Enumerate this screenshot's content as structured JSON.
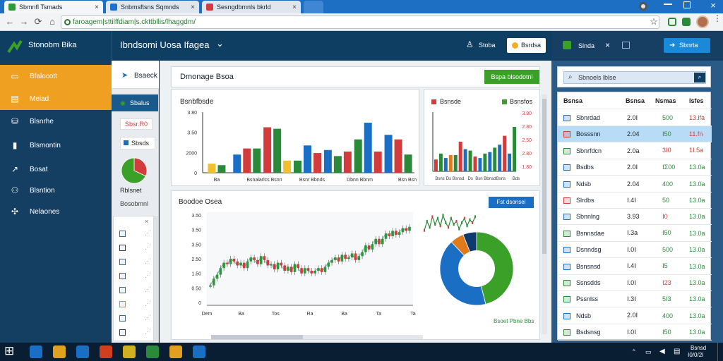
{
  "browser": {
    "tabs": [
      {
        "label": "Sbmnfl Tsmads",
        "icon_color": "#2d9b3a",
        "active": true
      },
      {
        "label": "Snbmsftsns Sqmnds",
        "icon_color": "#1c6fd1",
        "active": false
      },
      {
        "label": "Sesngdbmnls bkrld",
        "icon_color": "#d23c3c",
        "active": false
      }
    ],
    "tab_close": "×",
    "url": "faroagem|sttilffdiam|s.ckttbllis/lhaggdm/",
    "back": "←",
    "forward": "→",
    "reload": "⟳",
    "home": "⌂",
    "star": "☆"
  },
  "app": {
    "brand": "Stonobm Bika",
    "workspace": "Ibndsomi Uosa Ifagea",
    "workspace_caret": "⌄",
    "header_link": "Stoba",
    "header_button": "Bsrdsa",
    "right_header_label": "Slnda",
    "right_header_x": "×",
    "right_header_button": "Sbnrta"
  },
  "sidebar": {
    "items": [
      {
        "label": "Bfalocott",
        "icon": "folder-icon",
        "glyph": "▭",
        "active": true
      },
      {
        "label": "Meiad",
        "icon": "briefcase-icon",
        "glyph": "▤",
        "active": true
      },
      {
        "label": "Blsnrhe",
        "icon": "database-icon",
        "glyph": "⛁",
        "active": false
      },
      {
        "label": "Blsmontin",
        "icon": "document-icon",
        "glyph": "▮",
        "active": false
      },
      {
        "label": "Bosat",
        "icon": "chart-icon",
        "glyph": "↗",
        "active": false
      },
      {
        "label": "Blsntion",
        "icon": "people-icon",
        "glyph": "⚇",
        "active": false
      },
      {
        "label": "Nelaones",
        "icon": "network-icon",
        "glyph": "✣",
        "active": false
      }
    ]
  },
  "column2": {
    "search_label": "Bsaeck",
    "selected_item": "Sbalus",
    "red_value": "Sbsr.R0",
    "blue_item": "Sbsds",
    "pie_label": "Rblsnet",
    "pie_sublabel": "Bosobmnl",
    "list_rows": 8,
    "list_colors": [
      "#1a6fc4",
      "#3a3a3a",
      "#1a6fc4",
      "#1a6fc4",
      "#2a8a3a",
      "#e08a1a",
      "#1a6fc4",
      "#3a3a3a"
    ]
  },
  "main": {
    "page_title": "Dmonage Bsoa",
    "top_button": "Bspa blsodotnl",
    "panel_bar_title": "Bsnbfbsde",
    "panel_line_title": "Boodoe Osea",
    "side_button": "Fst dsonsel",
    "donut_caption": "Bsoet Pbne Bbs",
    "side_bar_legend": [
      "Bsnsde",
      "Bsnsfos"
    ]
  },
  "chart_data": [
    {
      "type": "bar",
      "title": "Bsnbfbsde",
      "yticks": [
        "3.80",
        "3.50",
        "2000",
        "0"
      ],
      "xticks": [
        "Ba",
        "Bsnalarlcs Bsnn",
        "Bsnr Bbnds",
        "Dbnn Bbnm",
        "Bsn Bsn"
      ],
      "ylim": [
        0,
        4
      ],
      "groups": [
        {
          "values": [
            0.6,
            0.5
          ],
          "colors": [
            "#f0c030",
            "#2a8a3a"
          ]
        },
        {
          "values": [
            1.2,
            1.6,
            1.6
          ],
          "colors": [
            "#1a6fc4",
            "#d23c3c",
            "#2a8a3a"
          ]
        },
        {
          "values": [
            3.0,
            2.9,
            0.8
          ],
          "colors": [
            "#d23c3c",
            "#2a8a3a",
            "#f0c030"
          ]
        },
        {
          "values": [
            0.8,
            1.8,
            1.3
          ],
          "colors": [
            "#2a8a3a",
            "#1a6fc4",
            "#d23c3c"
          ]
        },
        {
          "values": [
            1.5,
            1.1,
            1.4
          ],
          "colors": [
            "#1a6fc4",
            "#2a8a3a",
            "#d23c3c"
          ]
        },
        {
          "values": [
            2.2,
            3.3,
            1.4
          ],
          "colors": [
            "#2a8a3a",
            "#1a6fc4",
            "#d23c3c"
          ]
        },
        {
          "values": [
            2.5,
            2.2,
            1.2
          ],
          "colors": [
            "#1a6fc4",
            "#d23c3c",
            "#2a8a3a"
          ]
        }
      ]
    },
    {
      "type": "bar",
      "title": "Bsnsde",
      "yticks": [
        "3.80",
        "2.80",
        "2.50",
        "2.80",
        "1.80"
      ],
      "xticks": [
        "Bsns",
        "Ds Bsnsd",
        "Ds",
        "Bsn Bbnsd",
        "Bsns",
        "Bds"
      ],
      "ylim": [
        0,
        4
      ],
      "values": [
        0.8,
        1.2,
        0.9,
        1.1,
        1.1,
        2.0,
        1.5,
        1.4,
        1.0,
        0.9,
        1.2,
        1.3,
        1.6,
        1.8,
        2.4,
        1.2,
        3.0
      ],
      "colors": [
        "#d23c3c",
        "#2a8a3a",
        "#1a6fc4",
        "#e07a1a",
        "#2a8a3a",
        "#d23c3c",
        "#1a6fc4",
        "#2a8a3a",
        "#d23c3c",
        "#1a6fc4",
        "#2a8a3a",
        "#1a6fc4",
        "#2a8a3a",
        "#1a6fc4",
        "#d23c3c",
        "#1a6fc4",
        "#2a8a3a"
      ]
    },
    {
      "type": "line",
      "title": "Boodoe Osea",
      "yticks": [
        "3.50",
        "3.50",
        "3.50",
        "2.50",
        "1.50",
        "0.50",
        "0"
      ],
      "xticks": [
        "Dem",
        "Ba",
        "Tos",
        "Ra",
        "Ba",
        "Ta",
        "Ta"
      ],
      "ylim": [
        0,
        7
      ],
      "values": [
        1.5,
        2.0,
        2.3,
        2.8,
        3.2,
        3.1,
        3.5,
        3.3,
        3.0,
        3.2,
        2.8,
        3.3,
        3.6,
        3.4,
        3.1,
        3.7,
        3.4,
        3.0,
        3.1,
        2.7,
        3.2,
        3.0,
        2.6,
        2.9,
        2.5,
        3.1,
        2.8,
        2.4,
        2.8,
        2.6,
        2.4,
        2.6,
        2.8,
        2.5,
        2.9,
        3.2,
        3.4,
        3.6,
        3.3,
        3.8,
        3.5,
        3.6,
        3.9,
        3.4,
        3.7,
        4.0,
        4.5,
        4.2,
        4.6,
        5.0,
        4.6,
        5.0,
        5.4,
        5.2,
        5.6,
        5.3,
        5.5,
        5.8,
        5.6,
        5.9
      ]
    },
    {
      "type": "line",
      "title": "",
      "values": [
        2.0,
        2.6,
        2.2,
        2.9,
        2.4,
        2.8,
        2.3,
        3.0,
        2.5,
        2.2,
        2.8,
        2.4,
        2.6,
        2.1,
        2.5,
        2.8,
        2.3,
        2.7,
        2.5,
        2.9
      ]
    },
    {
      "type": "pie",
      "title": "Bsoet Pbne Bbs",
      "labels": [
        "Green",
        "Blue",
        "Orange",
        "Navy"
      ],
      "values": [
        46,
        42,
        6,
        6
      ],
      "colors": [
        "#3aa028",
        "#1a6fc4",
        "#e07a1a",
        "#0e3a6e"
      ],
      "donut": true
    },
    {
      "type": "pie",
      "title": "Rblsnet",
      "labels": [
        "Red",
        "Green"
      ],
      "values": [
        32,
        68
      ],
      "colors": [
        "#d23c3c",
        "#3aa028"
      ]
    }
  ],
  "right_panel": {
    "search_placeholder": "Sbnoels lblse",
    "columns": [
      "Bsnsa",
      "Bsnsa",
      "Nsmas",
      "Isfes"
    ],
    "rows": [
      {
        "name": "Sbnrdad",
        "v1": "2.0Ⅰ",
        "v2": "500",
        "v3": "13.lfa",
        "icon": "#1a6fc4",
        "v3color": "#d23c3c",
        "v2color": "#2a8a3a",
        "highlight": false
      },
      {
        "name": "Bosssnn",
        "v1": "2.04",
        "v2": "Ⅰ50",
        "v3": "11.fn",
        "icon": "#d23c3c",
        "v3color": "#d23c3c",
        "v2color": "#2a8a3a",
        "highlight": true
      },
      {
        "name": "Sbnrfdcn",
        "v1": "2.0a",
        "v2": "3Ⅰ0",
        "v3": "1Ⅰ.5a",
        "icon": "#2a8a3a",
        "v3color": "#d23c3c",
        "v2color": "#d23c3c",
        "highlight": false
      },
      {
        "name": "Bsdbs",
        "v1": "2.0Ⅰ",
        "v2": "ⅠΣ00",
        "v3": "13.0a",
        "icon": "#1a6fc4",
        "v3color": "#2a8a3a",
        "v2color": "#2a8a3a",
        "highlight": false
      },
      {
        "name": "Ndsb",
        "v1": "2.04",
        "v2": "400",
        "v3": "13.0a",
        "icon": "#1a6fc4",
        "v3color": "#2a8a3a",
        "v2color": "#2a8a3a",
        "highlight": false
      },
      {
        "name": "Slrdbs",
        "v1": "Ⅰ.4Ⅰ",
        "v2": "50",
        "v3": "13.0a",
        "icon": "#d23c3c",
        "v3color": "#2a8a3a",
        "v2color": "#2a8a3a",
        "highlight": false
      },
      {
        "name": "Sbnnlng",
        "v1": "3.93",
        "v2": "Ⅰ0",
        "v3": "13.0a",
        "icon": "#1a6fc4",
        "v3color": "#2a8a3a",
        "v2color": "#d23c3c",
        "highlight": false
      },
      {
        "name": "Bsnnsdae",
        "v1": "Ⅰ.3a",
        "v2": "Ⅰ50",
        "v3": "13.0a",
        "icon": "#2a8a3a",
        "v3color": "#2a8a3a",
        "v2color": "#2a8a3a",
        "highlight": false
      },
      {
        "name": "Dsnndsg",
        "v1": "Ⅰ.0Ⅰ",
        "v2": "500",
        "v3": "13.0a",
        "icon": "#1a6fc4",
        "v3color": "#2a8a3a",
        "v2color": "#2a8a3a",
        "highlight": false
      },
      {
        "name": "Bsnsnsd",
        "v1": "Ⅰ.4Ⅰ",
        "v2": "Ⅰ5",
        "v3": "13.0a",
        "icon": "#1a6fc4",
        "v3color": "#2a8a3a",
        "v2color": "#2a8a3a",
        "highlight": false
      },
      {
        "name": "Ssnsdds",
        "v1": "Ⅰ.0Ⅰ",
        "v2": "Ⅰ23",
        "v3": "13.0a",
        "icon": "#2a8a3a",
        "v3color": "#2a8a3a",
        "v2color": "#d23c3c",
        "highlight": false
      },
      {
        "name": "Pssnlss",
        "v1": "Ⅰ.3Ⅰ",
        "v2": "5Ⅰ3",
        "v3": "13.0a",
        "icon": "#2a8a3a",
        "v3color": "#2a8a3a",
        "v2color": "#2a8a3a",
        "highlight": false
      },
      {
        "name": "Ndsb",
        "v1": "2.0Ⅰ",
        "v2": "400",
        "v3": "13.0a",
        "icon": "#1a6fc4",
        "v3color": "#2a8a3a",
        "v2color": "#2a8a3a",
        "highlight": false
      },
      {
        "name": "Bsdsnsg",
        "v1": "Ⅰ.0Ⅰ",
        "v2": "Ⅰ50",
        "v3": "13.0a",
        "icon": "#2a8a3a",
        "v3color": "#2a8a3a",
        "v2color": "#2a8a3a",
        "highlight": false
      }
    ]
  },
  "taskbar": {
    "start_glyph": "⊞",
    "apps": [
      "#1a6fc4",
      "#e0a020",
      "#1a6fc4",
      "#d04020",
      "#d0b020",
      "#2a8a3a",
      "#e0a020",
      "#1a6fc4"
    ],
    "clock_time": "Bsnsd",
    "clock_date": "Ⅰ0/0/2Ⅰ"
  },
  "colors": {
    "accent": "#f0a020",
    "brand": "#0f3e63",
    "green_button": "#3aa028",
    "blue_button": "#1a8ad8"
  }
}
